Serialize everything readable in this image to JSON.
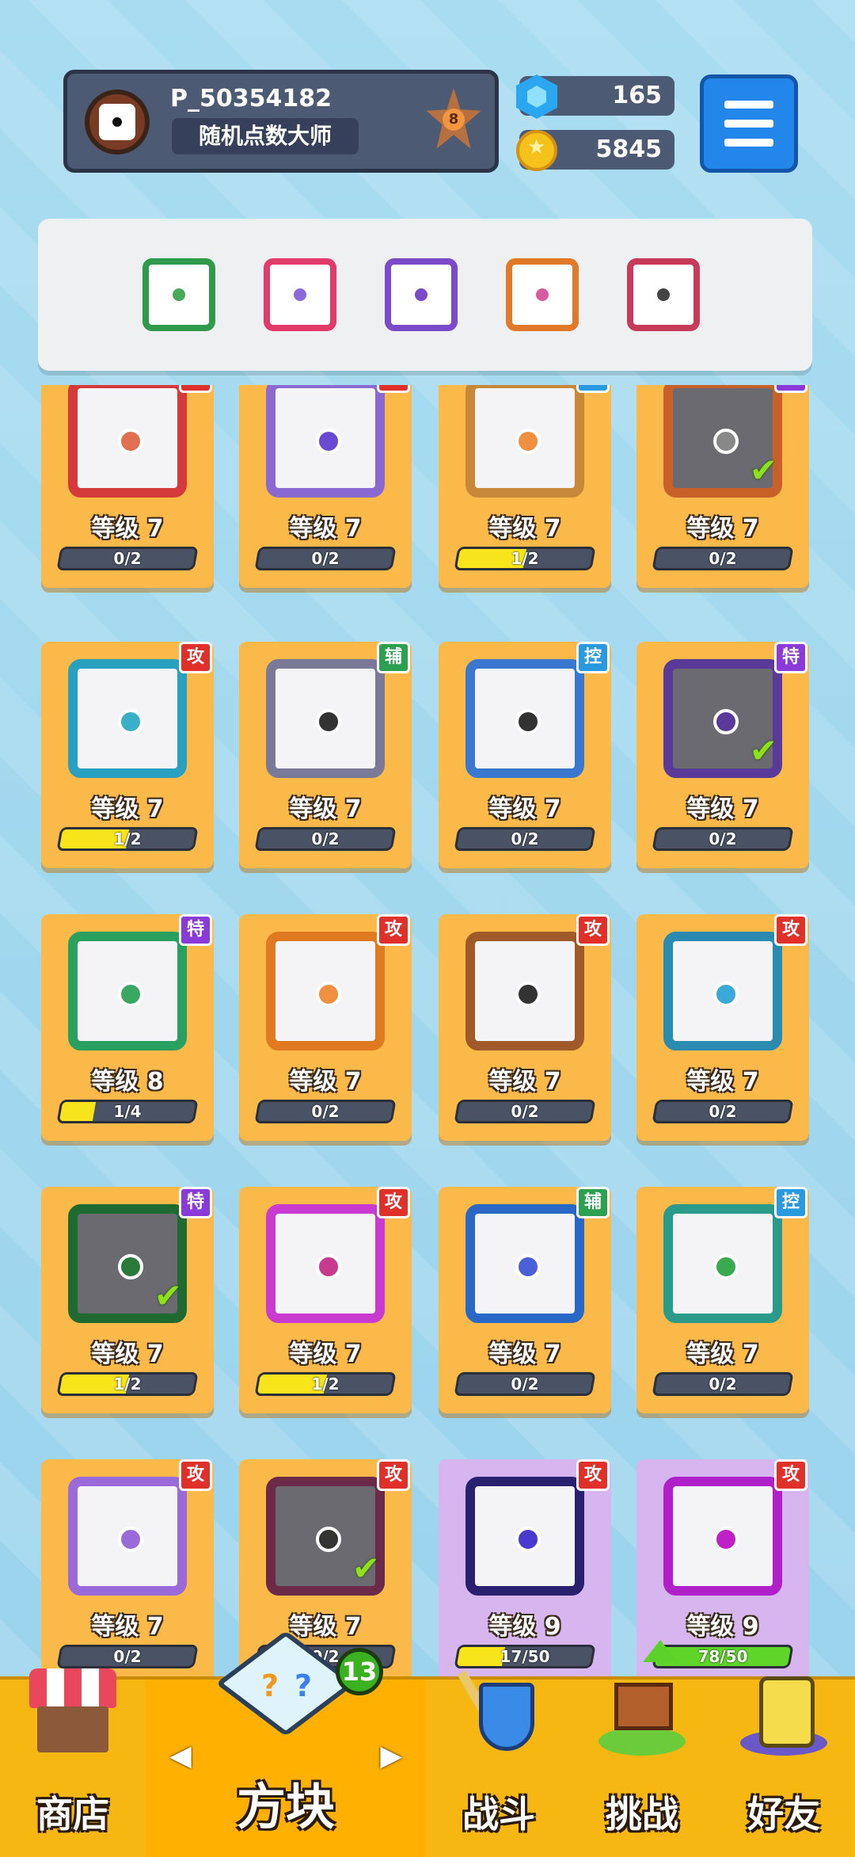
{
  "player": {
    "name": "P_50354182",
    "title": "随机点数大师",
    "rank": "8"
  },
  "currency": {
    "gems": "165",
    "coins": "5845"
  },
  "equipped": [
    {
      "name": "green-dragon-die-slot",
      "frame": "#2f9b4a",
      "dot": "#4aa85a"
    },
    {
      "name": "rainbow-die-slot",
      "frame": "#e23a6a",
      "dot": "#8a6ad8"
    },
    {
      "name": "purple-dragon-die-slot",
      "frame": "#7a4ac8",
      "dot": "#7a4ac8"
    },
    {
      "name": "infinity-dragon-die-slot",
      "frame": "#e07a28",
      "dot": "#d85aa0"
    },
    {
      "name": "blackhole-dragon-die-slot",
      "frame": "#c83a5a",
      "dot": "#444"
    }
  ],
  "cards": [
    {
      "level": "等级 7",
      "progress": "0/2",
      "fill": 0,
      "tag": "攻",
      "frame": "#d43a3a",
      "dot": "#e07050",
      "dark": false
    },
    {
      "level": "等级 7",
      "progress": "0/2",
      "fill": 0,
      "tag": "攻",
      "frame": "#8a6ad0",
      "dot": "#6a4ad0",
      "dark": false
    },
    {
      "level": "等级 7",
      "progress": "1/2",
      "fill": 0.5,
      "tag": "控",
      "frame": "#c8883a",
      "dot": "#f09040",
      "dark": false
    },
    {
      "level": "等级 7",
      "progress": "0/2",
      "fill": 0,
      "tag": "特",
      "frame": "#c8602a",
      "dot": "#888",
      "dark": true,
      "check": true
    },
    {
      "level": "等级 7",
      "progress": "1/2",
      "fill": 0.5,
      "tag": "攻",
      "frame": "#2aa0c0",
      "dot": "#3ab0c8",
      "dark": false
    },
    {
      "level": "等级 7",
      "progress": "0/2",
      "fill": 0,
      "tag": "辅",
      "frame": "#7a7a98",
      "dot": "#333",
      "dark": false
    },
    {
      "level": "等级 7",
      "progress": "0/2",
      "fill": 0,
      "tag": "控",
      "frame": "#3a78d0",
      "dot": "#333",
      "dark": false
    },
    {
      "level": "等级 7",
      "progress": "0/2",
      "fill": 0,
      "tag": "特",
      "frame": "#5a3a98",
      "dot": "#5a3a98",
      "dark": true,
      "check": true
    },
    {
      "level": "等级 8",
      "progress": "1/4",
      "fill": 0.25,
      "tag": "特",
      "frame": "#2aa060",
      "dot": "#3aa860",
      "dark": false
    },
    {
      "level": "等级 7",
      "progress": "0/2",
      "fill": 0,
      "tag": "攻",
      "frame": "#e07a20",
      "dot": "#f09040",
      "dark": false
    },
    {
      "level": "等级 7",
      "progress": "0/2",
      "fill": 0,
      "tag": "攻",
      "frame": "#a05a2a",
      "dot": "#333",
      "dark": false
    },
    {
      "level": "等级 7",
      "progress": "0/2",
      "fill": 0,
      "tag": "攻",
      "frame": "#2a8ab0",
      "dot": "#3aa8d8",
      "dark": false
    },
    {
      "level": "等级 7",
      "progress": "1/2",
      "fill": 0.5,
      "tag": "特",
      "frame": "#1f6a30",
      "dot": "#2a7a3a",
      "dark": true,
      "check": true
    },
    {
      "level": "等级 7",
      "progress": "1/2",
      "fill": 0.5,
      "tag": "攻",
      "frame": "#c83ad0",
      "dot": "#c83a90",
      "dark": false
    },
    {
      "level": "等级 7",
      "progress": "0/2",
      "fill": 0,
      "tag": "辅",
      "frame": "#2a68c8",
      "dot": "#4a60d8",
      "dark": false
    },
    {
      "level": "等级 7",
      "progress": "0/2",
      "fill": 0,
      "tag": "控",
      "frame": "#2a9a8a",
      "dot": "#3aaa50",
      "dark": false
    },
    {
      "level": "等级 7",
      "progress": "0/2",
      "fill": 0,
      "tag": "攻",
      "frame": "#9a6ad8",
      "dot": "#9a6ad8",
      "dark": false
    },
    {
      "level": "等级 7",
      "progress": "0/2",
      "fill": 0,
      "tag": "攻",
      "frame": "#6a2a48",
      "dot": "#333",
      "dark": true,
      "check": true
    },
    {
      "level": "等级 9",
      "progress": "17/50",
      "fill": 0.34,
      "tag": "攻",
      "frame": "#2a2070",
      "dot": "#4a3ad0",
      "dark": false,
      "purple": true
    },
    {
      "level": "等级 9",
      "progress": "78/50",
      "fill": 1,
      "tag": "攻",
      "frame": "#b020c8",
      "dot": "#c020c8",
      "dark": false,
      "purple": true,
      "green": true
    }
  ],
  "tag_colors": {
    "攻": "#e0302a",
    "控": "#2a9ae0",
    "特": "#8a3ad8",
    "辅": "#2aa050"
  },
  "nav": {
    "shop": "商店",
    "blocks": "方块",
    "blocks_badge": "13",
    "battle": "战斗",
    "challenge": "挑战",
    "friends": "好友"
  }
}
